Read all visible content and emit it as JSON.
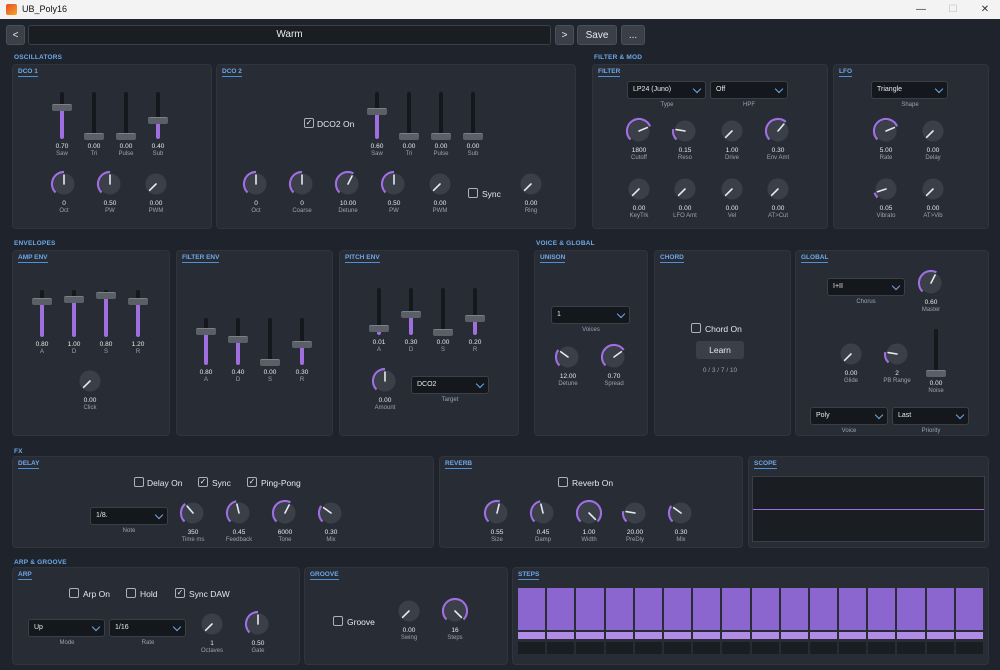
{
  "window": {
    "title": "UB_Poly16",
    "min": "—",
    "max": "☐",
    "close": "✕"
  },
  "header": {
    "prev": "<",
    "preset": "Warm",
    "next": ">",
    "save": "Save",
    "menu": "..."
  },
  "sections": {
    "osc": "OSCILLATORS",
    "filtermod": "FILTER & MOD",
    "env": "ENVELOPES",
    "voice": "VOICE & GLOBAL",
    "fx": "FX",
    "arp": "ARP & GROOVE"
  },
  "dco1": {
    "title": "DCO 1",
    "sliders": [
      {
        "label": "Saw",
        "value": "0.70",
        "level": 0.7
      },
      {
        "label": "Tri",
        "value": "0.00",
        "level": 0
      },
      {
        "label": "Pulse",
        "value": "0.00",
        "level": 0
      },
      {
        "label": "Sub",
        "value": "0.40",
        "level": 0.4
      }
    ],
    "knobs": [
      {
        "label": "Oct",
        "value": "0",
        "pos": 0.5
      },
      {
        "label": "PW",
        "value": "0.50",
        "pos": 0.5
      },
      {
        "label": "PWM",
        "value": "0.00",
        "pos": 0
      }
    ]
  },
  "dco2": {
    "title": "DCO 2",
    "on_label": "DCO2 On",
    "sync_label": "Sync",
    "sliders": [
      {
        "label": "Saw",
        "value": "0.60",
        "level": 0.6
      },
      {
        "label": "Tri",
        "value": "0.00",
        "level": 0
      },
      {
        "label": "Pulse",
        "value": "0.00",
        "level": 0
      },
      {
        "label": "Sub",
        "value": "0.00",
        "level": 0
      }
    ],
    "knobs": [
      {
        "label": "Oct",
        "value": "0",
        "pos": 0.5
      },
      {
        "label": "Coarse",
        "value": "0",
        "pos": 0.5
      },
      {
        "label": "Detune",
        "value": "10.00",
        "pos": 0.6
      },
      {
        "label": "PW",
        "value": "0.50",
        "pos": 0.5
      },
      {
        "label": "PWM",
        "value": "0.00",
        "pos": 0
      }
    ],
    "ring": {
      "label": "Ring",
      "value": "0.00",
      "pos": 0
    }
  },
  "filter": {
    "title": "FILTER",
    "type": "LP24 (Juno)",
    "type_label": "Type",
    "hpf": "Off",
    "hpf_label": "HPF",
    "knobs": [
      {
        "label": "Cutoff",
        "value": "1800",
        "pos": 0.75
      },
      {
        "label": "Reso",
        "value": "0.15",
        "pos": 0.2
      },
      {
        "label": "Drive",
        "value": "1.00",
        "pos": 0
      },
      {
        "label": "Env Amt",
        "value": "0.30",
        "pos": 0.65
      },
      {
        "label": "KeyTrk",
        "value": "0.00",
        "pos": 0
      },
      {
        "label": "LFO Amt",
        "value": "0.00",
        "pos": 0
      },
      {
        "label": "Vel",
        "value": "0.00",
        "pos": 0
      },
      {
        "label": "AT>Cut",
        "value": "0.00",
        "pos": 0
      }
    ]
  },
  "lfo": {
    "title": "LFO",
    "shape": "Triangle",
    "shape_label": "Shape",
    "knobs": [
      {
        "label": "Rate",
        "value": "5.00",
        "pos": 0.75
      },
      {
        "label": "Delay",
        "value": "0.00",
        "pos": 0
      },
      {
        "label": "Vibrato",
        "value": "0.05",
        "pos": 0.1
      },
      {
        "label": "AT>Vib",
        "value": "0.00",
        "pos": 0
      }
    ]
  },
  "ampenv": {
    "title": "AMP ENV",
    "sliders": [
      {
        "label": "A",
        "value": "0.80",
        "level": 0.8
      },
      {
        "label": "D",
        "value": "1.00",
        "level": 0.85
      },
      {
        "label": "S",
        "value": "0.80",
        "level": 0.95
      },
      {
        "label": "R",
        "value": "1.20",
        "level": 0.8
      }
    ],
    "click": {
      "label": "Click",
      "value": "0.00",
      "pos": 0
    }
  },
  "filterenv": {
    "title": "FILTER ENV",
    "sliders": [
      {
        "label": "A",
        "value": "0.80",
        "level": 0.75
      },
      {
        "label": "D",
        "value": "0.40",
        "level": 0.55
      },
      {
        "label": "S",
        "value": "0.00",
        "level": 0
      },
      {
        "label": "R",
        "value": "0.30",
        "level": 0.45
      }
    ]
  },
  "pitchenv": {
    "title": "PITCH ENV",
    "sliders": [
      {
        "label": "A",
        "value": "0.01",
        "level": 0.1
      },
      {
        "label": "D",
        "value": "0.30",
        "level": 0.45
      },
      {
        "label": "S",
        "value": "0.00",
        "level": 0
      },
      {
        "label": "R",
        "value": "0.20",
        "level": 0.35
      }
    ],
    "amount": {
      "label": "Amount",
      "value": "0.00",
      "pos": 0.5
    },
    "target": "DCO2",
    "target_label": "Target"
  },
  "unison": {
    "title": "UNISON",
    "voices": "1",
    "voices_label": "Voices",
    "knobs": [
      {
        "label": "Detune",
        "value": "12.00",
        "pos": 0.3
      },
      {
        "label": "Spread",
        "value": "0.70",
        "pos": 0.7
      }
    ]
  },
  "chord": {
    "title": "CHORD",
    "on_label": "Chord On",
    "learn": "Learn",
    "notes": "0 / 3 / 7 / 10"
  },
  "global": {
    "title": "GLOBAL",
    "chorus": "I+II",
    "chorus_label": "Chorus",
    "master": {
      "label": "Master",
      "value": "0.60",
      "pos": 0.6
    },
    "glide": {
      "label": "Glide",
      "value": "0.00",
      "pos": 0
    },
    "pbrange": {
      "label": "PB Range",
      "value": "2",
      "pos": 0.2
    },
    "noise": {
      "label": "Noise",
      "value": "0.00",
      "level": 0
    },
    "voice": "Poly",
    "voice_label": "Voice",
    "priority": "Last",
    "priority_label": "Priority"
  },
  "delay": {
    "title": "DELAY",
    "on_label": "Delay On",
    "sync_label": "Sync",
    "pingpong_label": "Ping-Pong",
    "note": "1/8.",
    "note_label": "Note",
    "knobs": [
      {
        "label": "Time ms",
        "value": "350",
        "pos": 0.35
      },
      {
        "label": "Feedback",
        "value": "0.45",
        "pos": 0.45
      },
      {
        "label": "Tone",
        "value": "6000",
        "pos": 0.6
      },
      {
        "label": "Mix",
        "value": "0.30",
        "pos": 0.3
      }
    ]
  },
  "reverb": {
    "title": "REVERB",
    "on_label": "Reverb On",
    "knobs": [
      {
        "label": "Size",
        "value": "0.55",
        "pos": 0.55
      },
      {
        "label": "Damp",
        "value": "0.45",
        "pos": 0.45
      },
      {
        "label": "Width",
        "value": "1.00",
        "pos": 1
      },
      {
        "label": "PreDly",
        "value": "20.00",
        "pos": 0.2
      },
      {
        "label": "Mix",
        "value": "0.30",
        "pos": 0.3
      }
    ]
  },
  "scope": {
    "title": "SCOPE"
  },
  "arp": {
    "title": "ARP",
    "on_label": "Arp On",
    "hold_label": "Hold",
    "syncdaw_label": "Sync DAW",
    "mode": "Up",
    "mode_label": "Mode",
    "rate": "1/16",
    "rate_label": "Rate",
    "knobs": [
      {
        "label": "Octaves",
        "value": "1",
        "pos": 0
      },
      {
        "label": "Gate",
        "value": "0.50",
        "pos": 0.5
      }
    ]
  },
  "groove": {
    "title": "GROOVE",
    "on_label": "Groove",
    "knobs": [
      {
        "label": "Swing",
        "value": "0.00",
        "pos": 0
      },
      {
        "label": "Steps",
        "value": "16",
        "pos": 1
      }
    ]
  },
  "steps": {
    "title": "STEPS",
    "count": 16
  },
  "colors": {
    "accent": "#9f6fe0",
    "title": "#6fa8e8",
    "panel": "#272c35",
    "bg": "#1f242c"
  }
}
